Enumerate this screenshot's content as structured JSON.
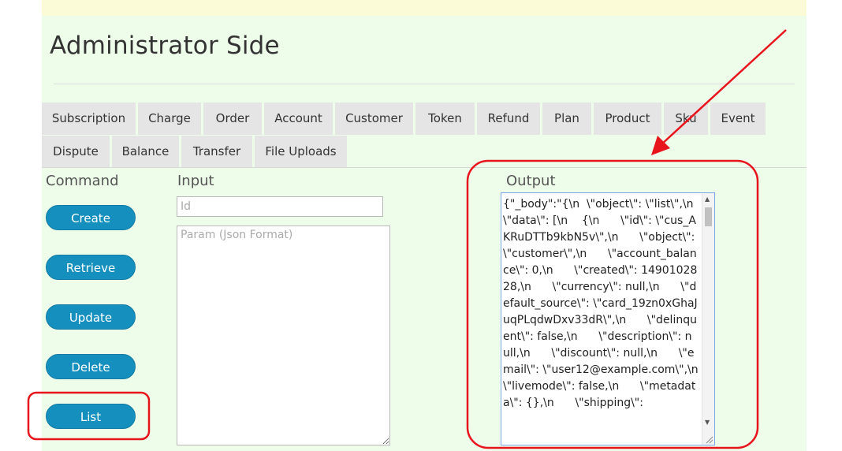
{
  "header": {
    "title": "Administrator Side"
  },
  "tabs": [
    "Subscription",
    "Charge",
    "Order",
    "Account",
    "Customer",
    "Token",
    "Refund",
    "Plan",
    "Product",
    "Sku",
    "Event",
    "Dispute",
    "Balance",
    "Transfer",
    "File Uploads"
  ],
  "command": {
    "label": "Command",
    "buttons": [
      "Create",
      "Retrieve",
      "Update",
      "Delete",
      "List"
    ]
  },
  "input": {
    "label": "Input",
    "id_placeholder": "Id",
    "param_placeholder": "Param (Json Format)"
  },
  "output": {
    "label": "Output",
    "text": "{\"_body\":\"{\\n  \\\"object\\\": \\\"list\\\",\\n  \\\"data\\\": [\\n    {\\n      \\\"id\\\": \\\"cus_AKRuDTTb9kbN5v\\\",\\n      \\\"object\\\": \\\"customer\\\",\\n      \\\"account_balance\\\": 0,\\n      \\\"created\\\": 1490102828,\\n      \\\"currency\\\": null,\\n      \\\"default_source\\\": \\\"card_19zn0xGhaJuqPLqdwDxv33dR\\\",\\n      \\\"delinquent\\\": false,\\n      \\\"description\\\": null,\\n      \\\"discount\\\": null,\\n      \\\"email\\\": \\\"user12@example.com\\\",\\n      \\\"livemode\\\": false,\\n      \\\"metadata\\\": {},\\n      \\\"shipping\\\":"
  },
  "colors": {
    "button": "#1590be",
    "panel": "#eefdea",
    "topbar": "#fbfbd8",
    "annotation": "#e8141b"
  }
}
